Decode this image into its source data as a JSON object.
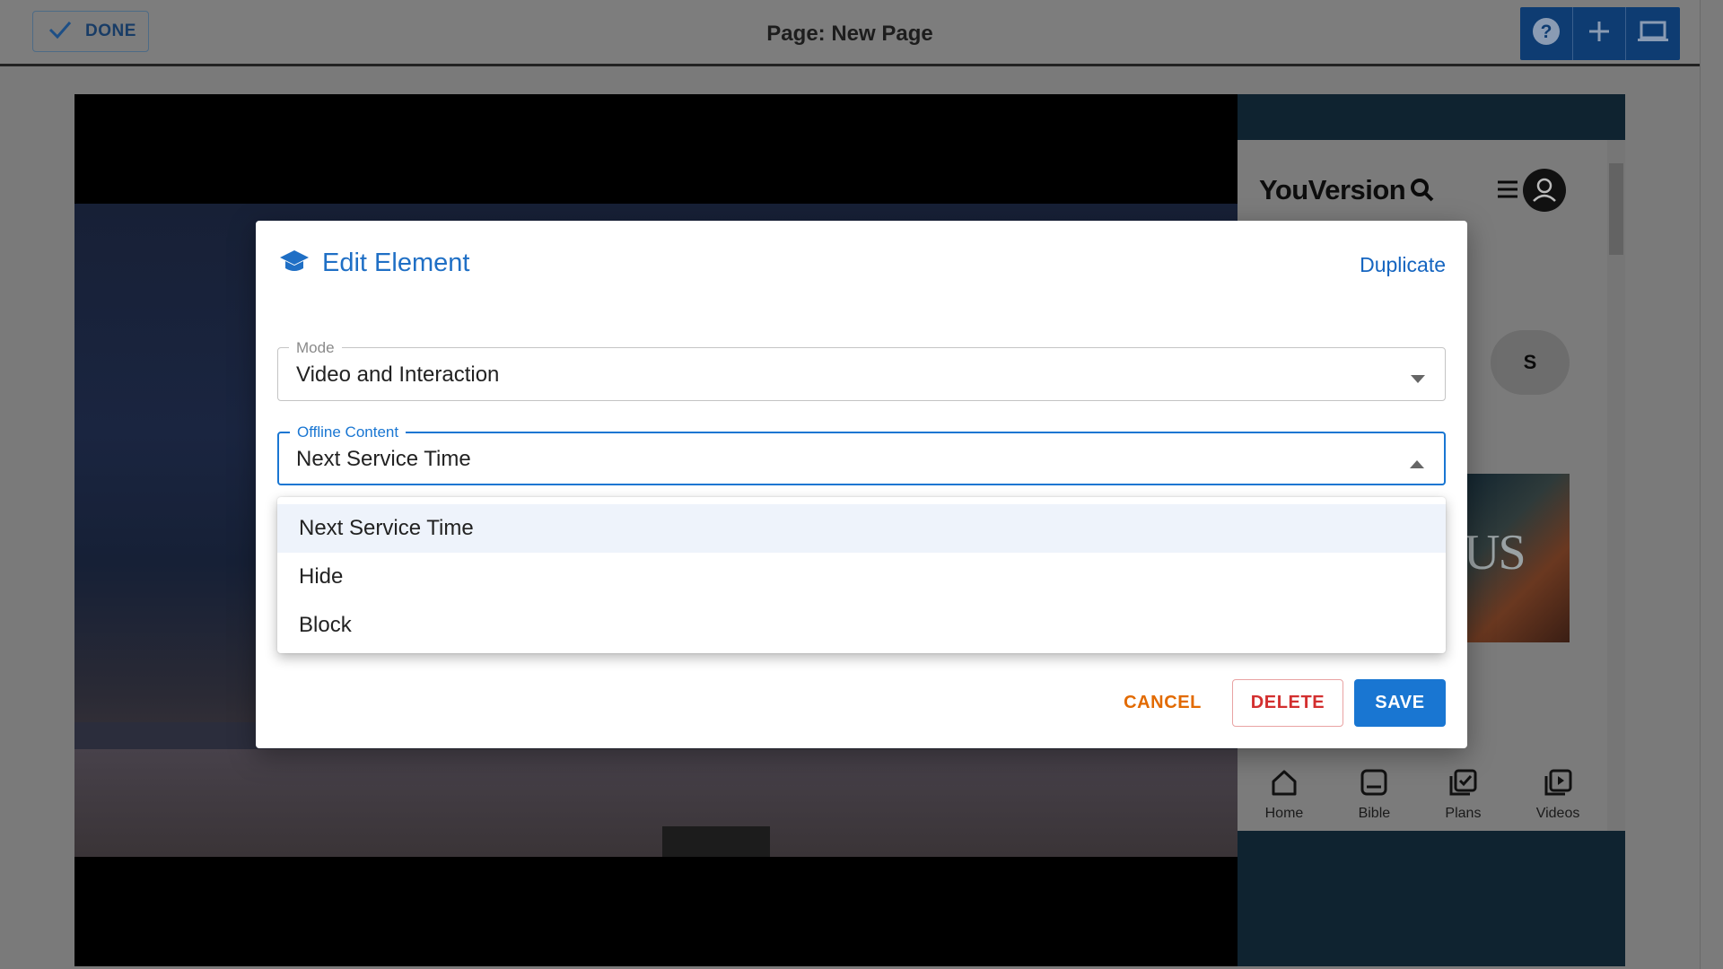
{
  "topbar": {
    "done_label": "DONE",
    "page_title": "Page: New Page",
    "tools": [
      "help-icon",
      "add-icon",
      "laptop-icon"
    ]
  },
  "preview_app": {
    "brand": "YouVersion",
    "pill_text": "S",
    "art_text": "US",
    "tabs": [
      {
        "label": "Home",
        "icon": "home-icon"
      },
      {
        "label": "Bible",
        "icon": "bible-icon"
      },
      {
        "label": "Plans",
        "icon": "plans-icon"
      },
      {
        "label": "Videos",
        "icon": "videos-icon"
      }
    ]
  },
  "modal": {
    "title": "Edit Element",
    "title_icon": "graduation-cap-icon",
    "duplicate_label": "Duplicate",
    "mode": {
      "legend": "Mode",
      "value": "Video and Interaction"
    },
    "offline": {
      "legend": "Offline Content",
      "value": "Next Service Time"
    },
    "options": [
      "Next Service Time",
      "Hide",
      "Block"
    ],
    "selected_option": "Next Service Time",
    "buttons": {
      "cancel": "CANCEL",
      "delete": "DELETE",
      "save": "SAVE"
    }
  },
  "colors": {
    "accent": "#1976d2",
    "cancel": "#e26a00",
    "delete": "#d32f2f",
    "toolbar": "#0e3c72"
  }
}
